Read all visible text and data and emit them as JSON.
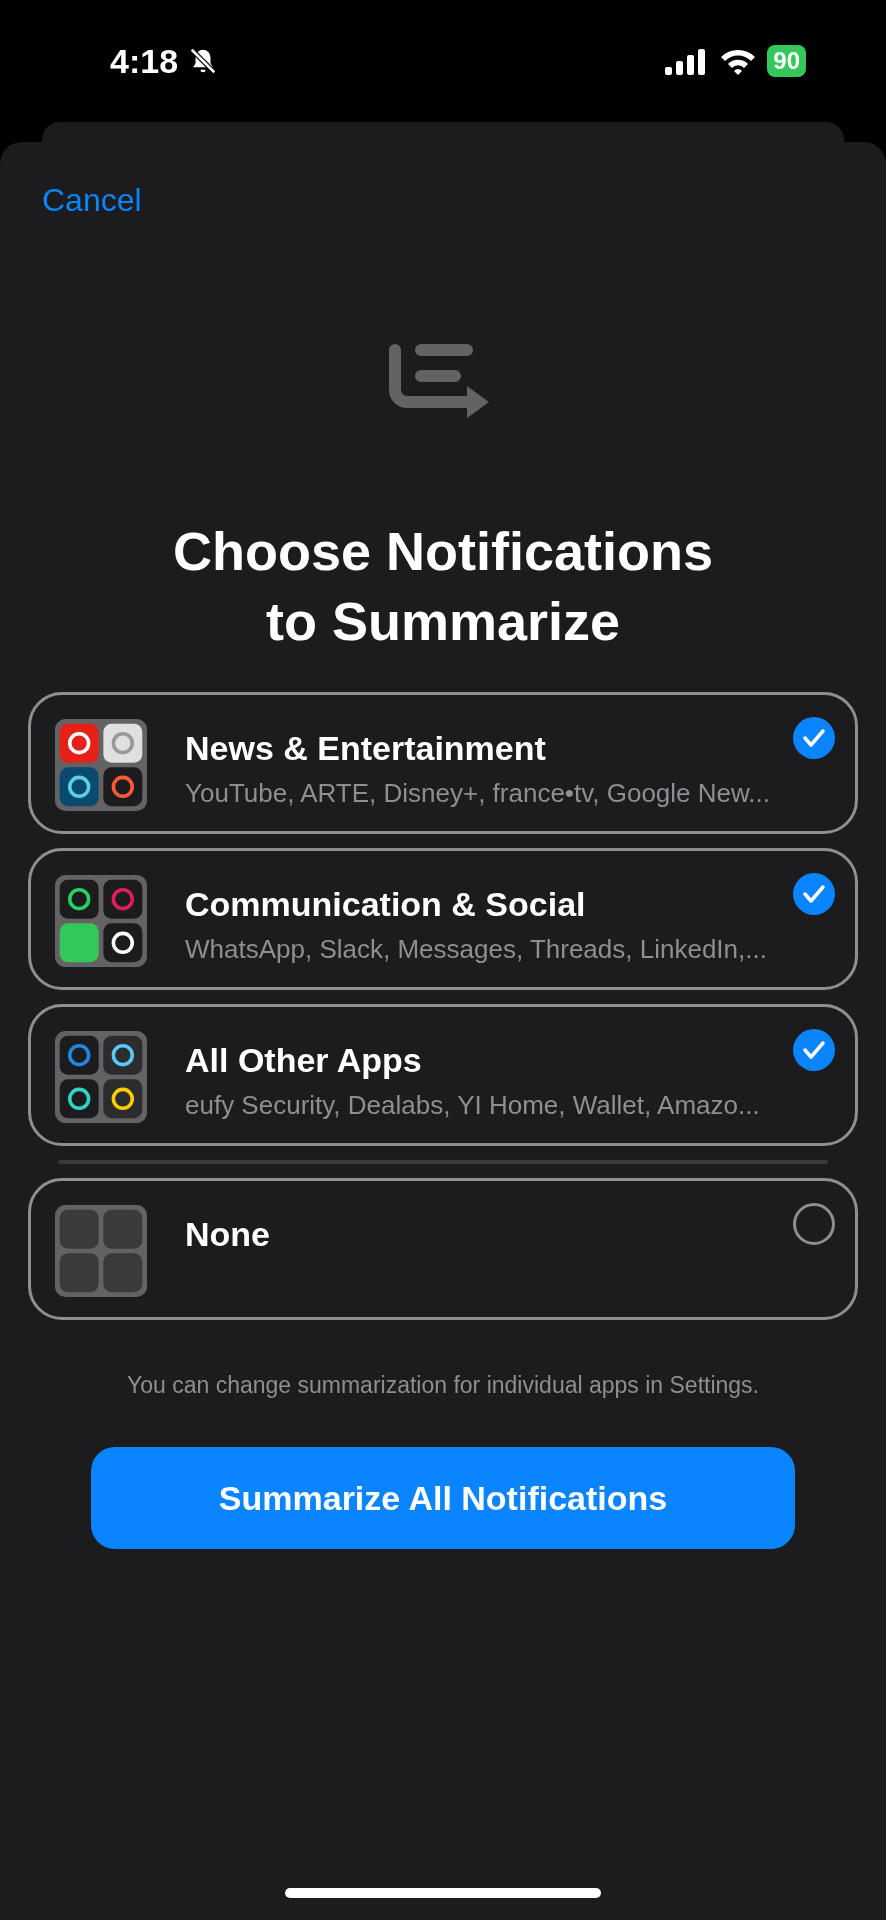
{
  "status_bar": {
    "time": "4:18",
    "silent": true,
    "battery": "90"
  },
  "sheet": {
    "cancel": "Cancel",
    "title": "Choose Notifications\nto Summarize",
    "options": [
      {
        "kind": "apps",
        "title": "News & Entertainment",
        "subtitle": "YouTube, ARTE, Disney+, france•tv, Google New...",
        "selected": true
      },
      {
        "kind": "apps",
        "title": "Communication & Social",
        "subtitle": "WhatsApp, Slack, Messages, Threads, LinkedIn,...",
        "selected": true
      },
      {
        "kind": "apps",
        "title": "All Other Apps",
        "subtitle": "eufy Security, Dealabs, YI Home, Wallet, Amazo...",
        "selected": true
      },
      {
        "kind": "none",
        "title": "None",
        "selected": false
      }
    ],
    "footnote": "You can change summarization for individual apps in Settings.",
    "button": "Summarize All Notifications"
  }
}
